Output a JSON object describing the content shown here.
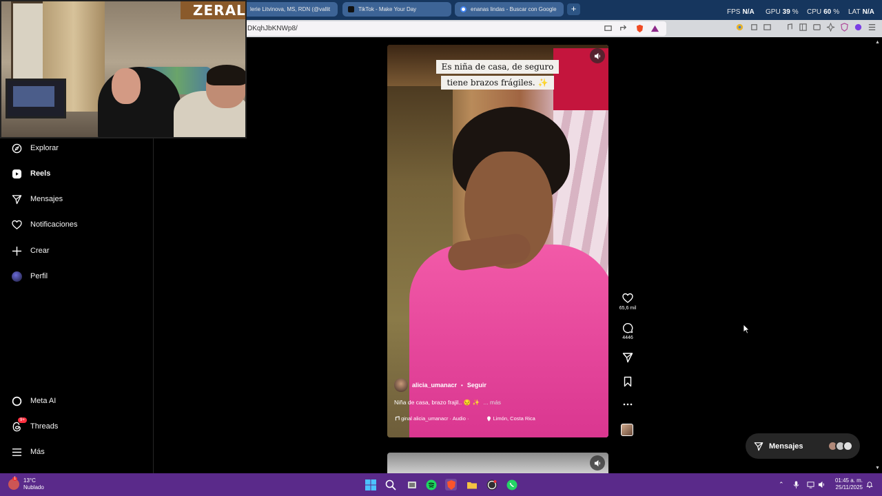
{
  "browser": {
    "tabs": [
      {
        "label": "lerie Litvinova, MS, RDN (@vallit",
        "icon_color": "#c13584"
      },
      {
        "label": "TikTok - Make Your Day",
        "icon_color": "#111111"
      },
      {
        "label": "enanas lindas - Buscar con Google",
        "icon_color": "#4285f4"
      }
    ],
    "new_tab_label": "+",
    "url": "DKqhJbKNWp8/"
  },
  "stats_overlay": {
    "fps_label": "FPS",
    "fps_value": "N/A",
    "gpu_label": "GPU",
    "gpu_value": "39",
    "cpu_label": "CPU",
    "cpu_value": "60",
    "lat_label": "LAT",
    "lat_value": "N/A",
    "percent": "%"
  },
  "webcam": {
    "brand_text": "ZERAL"
  },
  "sidebar": {
    "items": [
      {
        "label": "Explorar",
        "icon": "compass-icon"
      },
      {
        "label": "Reels",
        "icon": "reels-icon"
      },
      {
        "label": "Mensajes",
        "icon": "paper-plane-icon"
      },
      {
        "label": "Notificaciones",
        "icon": "heart-icon"
      },
      {
        "label": "Crear",
        "icon": "plus-icon"
      },
      {
        "label": "Perfil",
        "icon": "avatar-icon"
      }
    ],
    "bottom_items": [
      {
        "label": "Meta AI",
        "icon": "meta-ai-icon"
      },
      {
        "label": "Threads",
        "icon": "threads-icon",
        "badge": "9+"
      },
      {
        "label": "Más",
        "icon": "menu-icon"
      }
    ]
  },
  "reel": {
    "caption_sticker": "Es niña de casa, de seguro tiene brazos frágiles. ✨",
    "username": "alicia_umanacr",
    "separator": "•",
    "follow_label": "Seguir",
    "description": "Niña de casa, brazo frajil.. 😔 ✨",
    "more_label": "... más",
    "audio_text": "ginal  alicia_umanacr · Audio ·",
    "location": "Limón, Costa Rica",
    "likes": "65,6 mil",
    "comments": "4446"
  },
  "dm_pill": {
    "label": "Mensajes"
  },
  "taskbar": {
    "temperature": "13°C",
    "condition": "Nublado",
    "time": "01:45 a. m.",
    "date": "25/11/2025",
    "weather_badge": "1"
  }
}
